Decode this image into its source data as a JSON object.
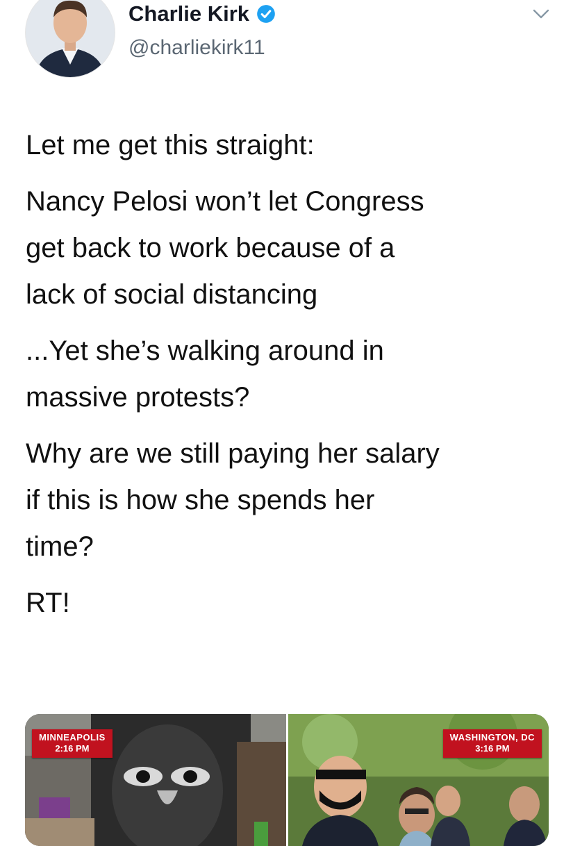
{
  "author": {
    "display_name": "Charlie Kirk",
    "handle": "@charliekirk11",
    "verified": true,
    "avatar_icon": "profile-photo"
  },
  "menu_icon": "chevron-down-icon",
  "tweet": {
    "paragraphs": [
      "Let me get this straight:",
      "Nancy Pelosi won’t let Congress\nget back to work because of a\nlack of social distancing",
      "...Yet she’s walking around in\nmassive protests?",
      "Why are we still paying her salary\nif this is how she spends her\ntime?",
      "RT!"
    ]
  },
  "media": {
    "left": {
      "location": "MINNEAPOLIS",
      "time": "2:16 PM"
    },
    "right": {
      "location": "WASHINGTON, DC",
      "time": "3:16 PM"
    }
  },
  "colors": {
    "verified_blue": "#1da1f2",
    "lower_third_red": "#c1121f",
    "handle_gray": "#5b6773"
  }
}
